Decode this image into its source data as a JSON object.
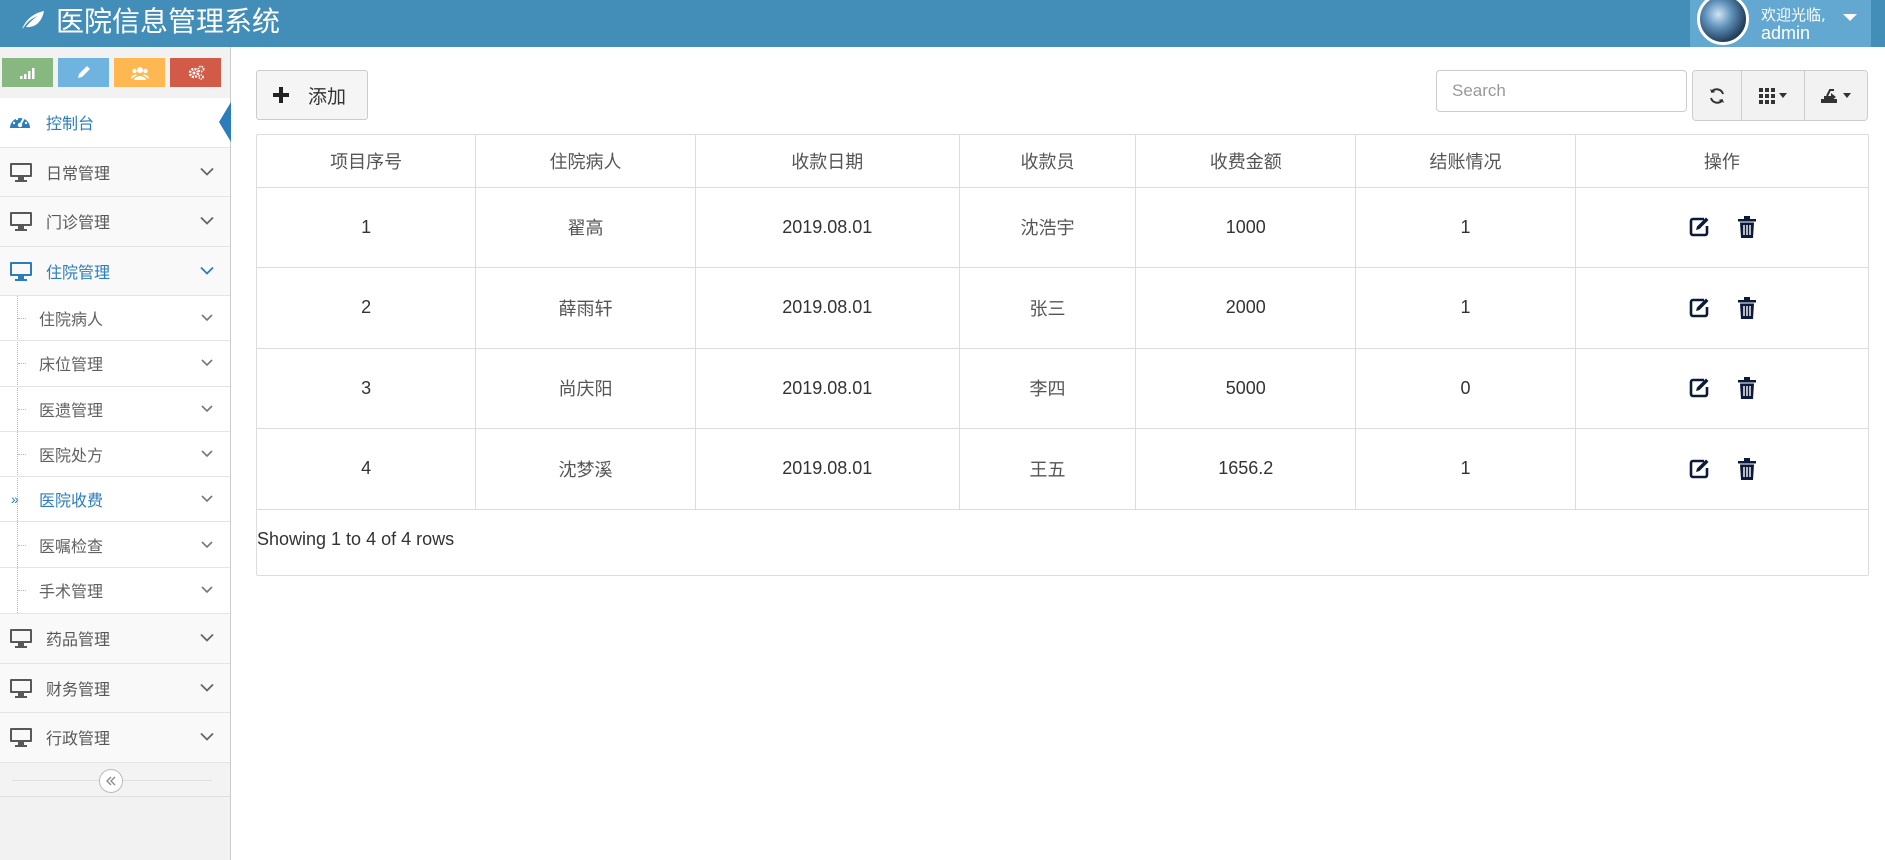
{
  "app": {
    "title": "医院信息管理系统"
  },
  "user": {
    "welcome": "欢迎光临,",
    "name": "admin"
  },
  "sidebar": {
    "items": [
      {
        "label": "控制台"
      },
      {
        "label": "日常管理"
      },
      {
        "label": "门诊管理"
      },
      {
        "label": "住院管理"
      },
      {
        "label": "药品管理"
      },
      {
        "label": "财务管理"
      },
      {
        "label": "行政管理"
      }
    ],
    "submenu": [
      {
        "label": "住院病人"
      },
      {
        "label": "床位管理"
      },
      {
        "label": "医遗管理"
      },
      {
        "label": "医院处方"
      },
      {
        "label": "医院收费"
      },
      {
        "label": "医嘱检查"
      },
      {
        "label": "手术管理"
      }
    ],
    "current_marker": "»"
  },
  "toolbar": {
    "add_label": "添加",
    "search_placeholder": "Search"
  },
  "table": {
    "headers": [
      "项目序号",
      "住院病人",
      "收款日期",
      "收款员",
      "收费金额",
      "结账情况",
      "操作"
    ],
    "rows": [
      [
        "1",
        "翟高",
        "2019.08.01",
        "沈浩宇",
        "1000",
        "1"
      ],
      [
        "2",
        "薛雨轩",
        "2019.08.01",
        "张三",
        "2000",
        "1"
      ],
      [
        "3",
        "尚庆阳",
        "2019.08.01",
        "李四",
        "5000",
        "0"
      ],
      [
        "4",
        "沈梦溪",
        "2019.08.01",
        "王五",
        "1656.2",
        "1"
      ]
    ],
    "footer": "Showing 1 to 4 of 4 rows"
  },
  "colors": {
    "header": "#438eb9",
    "user_box": "#62a8d1",
    "accent": "#2b7dbc",
    "shortcut_green": "#87b87f",
    "shortcut_blue": "#6fb3e0",
    "shortcut_orange": "#ffb752",
    "shortcut_red": "#d15b47"
  },
  "icons": [
    "leaf-icon",
    "signal-icon",
    "pencil-icon",
    "users-icon",
    "cogs-icon",
    "dashboard-icon",
    "desktop-icon",
    "chevron-down-icon",
    "plus-icon",
    "refresh-icon",
    "columns-icon",
    "export-icon",
    "edit-icon",
    "trash-icon",
    "double-angle-left-icon"
  ]
}
